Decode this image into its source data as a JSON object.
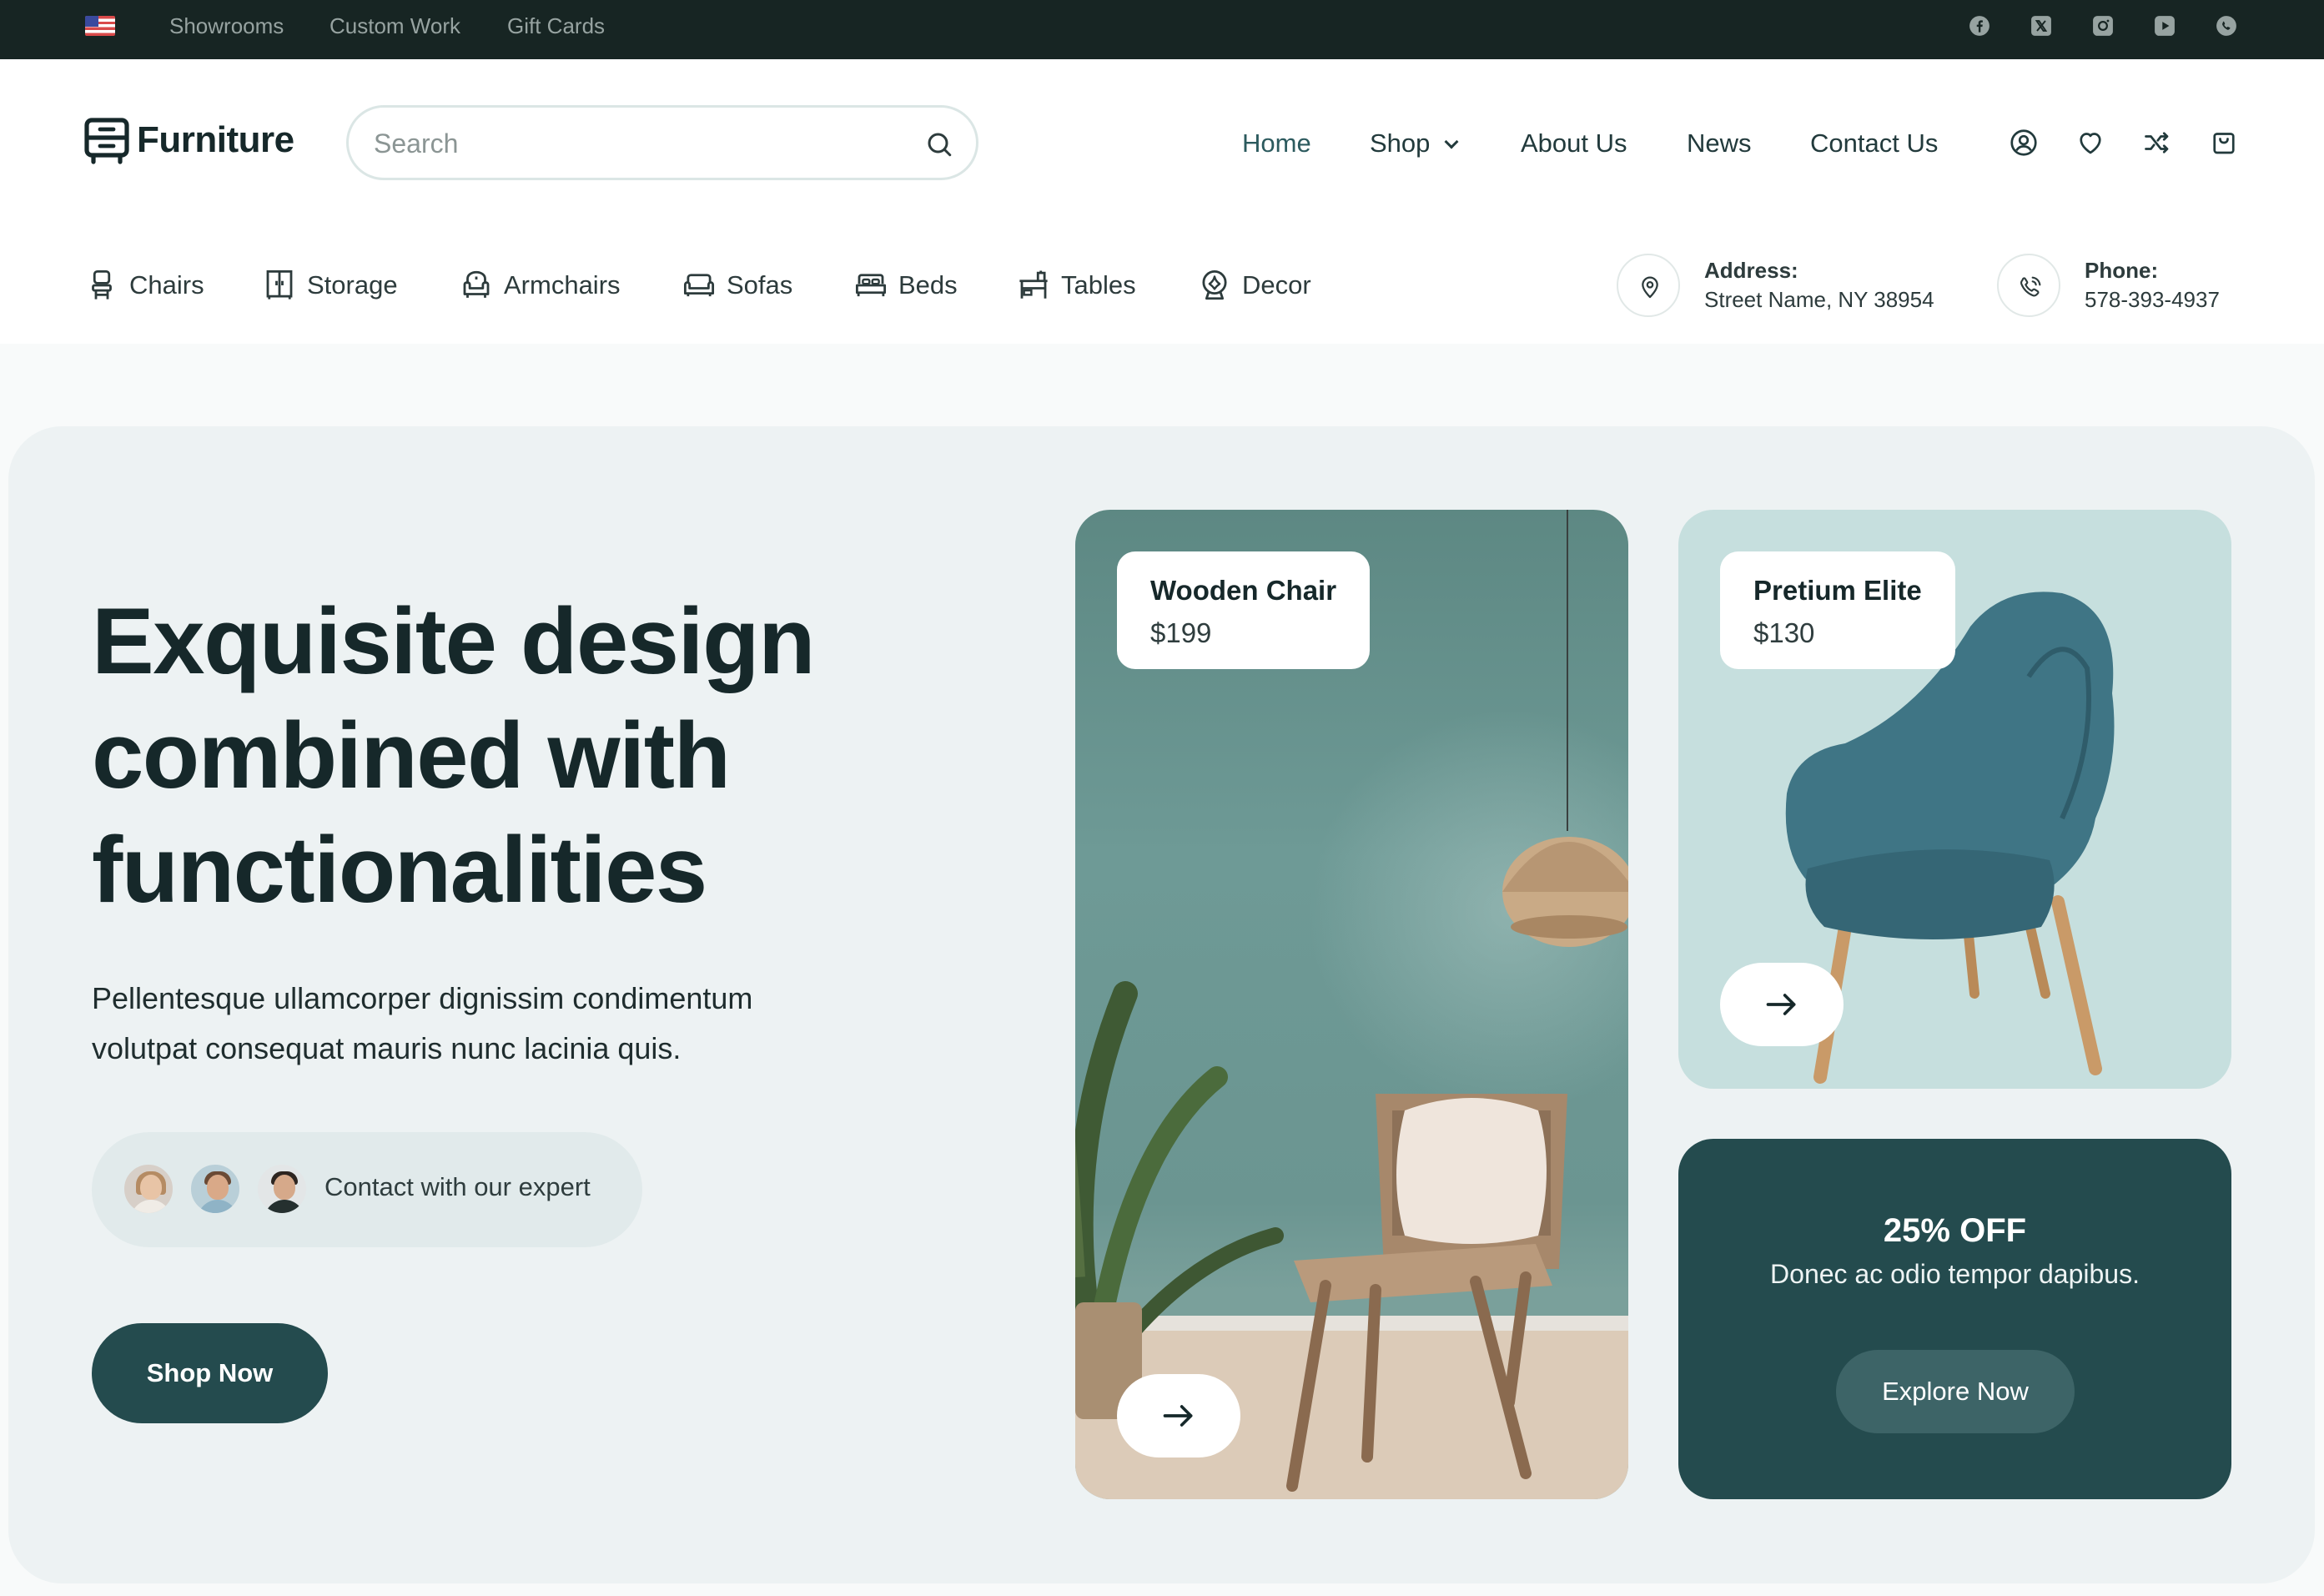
{
  "topbar": {
    "flag_icon": "us-flag-icon",
    "links": [
      "Showrooms",
      "Custom Work",
      "Gift Cards"
    ],
    "socials": [
      "facebook-icon",
      "x-icon",
      "instagram-icon",
      "youtube-icon",
      "whatsapp-icon"
    ]
  },
  "header": {
    "logo_text": "Furniture",
    "search_placeholder": "Search",
    "nav": [
      "Home",
      "Shop",
      "About Us",
      "News",
      "Contact Us"
    ],
    "icons": [
      "user-icon",
      "heart-icon",
      "compare-icon",
      "cart-icon"
    ]
  },
  "categories": [
    {
      "label": "Chairs",
      "icon": "chair-icon"
    },
    {
      "label": "Storage",
      "icon": "storage-icon"
    },
    {
      "label": "Armchairs",
      "icon": "armchair-icon"
    },
    {
      "label": "Sofas",
      "icon": "sofa-icon"
    },
    {
      "label": "Beds",
      "icon": "bed-icon"
    },
    {
      "label": "Tables",
      "icon": "table-icon"
    },
    {
      "label": "Decor",
      "icon": "decor-icon"
    }
  ],
  "contact": {
    "address_label": "Address:",
    "address_value": "Street Name, NY 38954",
    "phone_label": "Phone:",
    "phone_value": "578-393-4937"
  },
  "hero": {
    "headline": [
      "Exquisite design",
      "combined with",
      "functionalities"
    ],
    "subtitle": "Pellentesque ullamcorper dignissim condimentum volutpat consequat mauris nunc lacinia quis.",
    "expert_label": "Contact with our expert",
    "shop_button": "Shop Now"
  },
  "products": [
    {
      "name": "Wooden Chair",
      "price": "$199"
    },
    {
      "name": "Pretium Elite",
      "price": "$130"
    }
  ],
  "promo": {
    "title": "25% OFF",
    "subtitle": "Donec ac odio tempor dapibus.",
    "button": "Explore Now"
  },
  "colors": {
    "topbar_bg": "#172523",
    "brand_dark": "#244b4e",
    "hero_bg": "#edf2f3",
    "chair_card_bg": "#c6dfde",
    "wood_card_bg": "#6b9591"
  }
}
